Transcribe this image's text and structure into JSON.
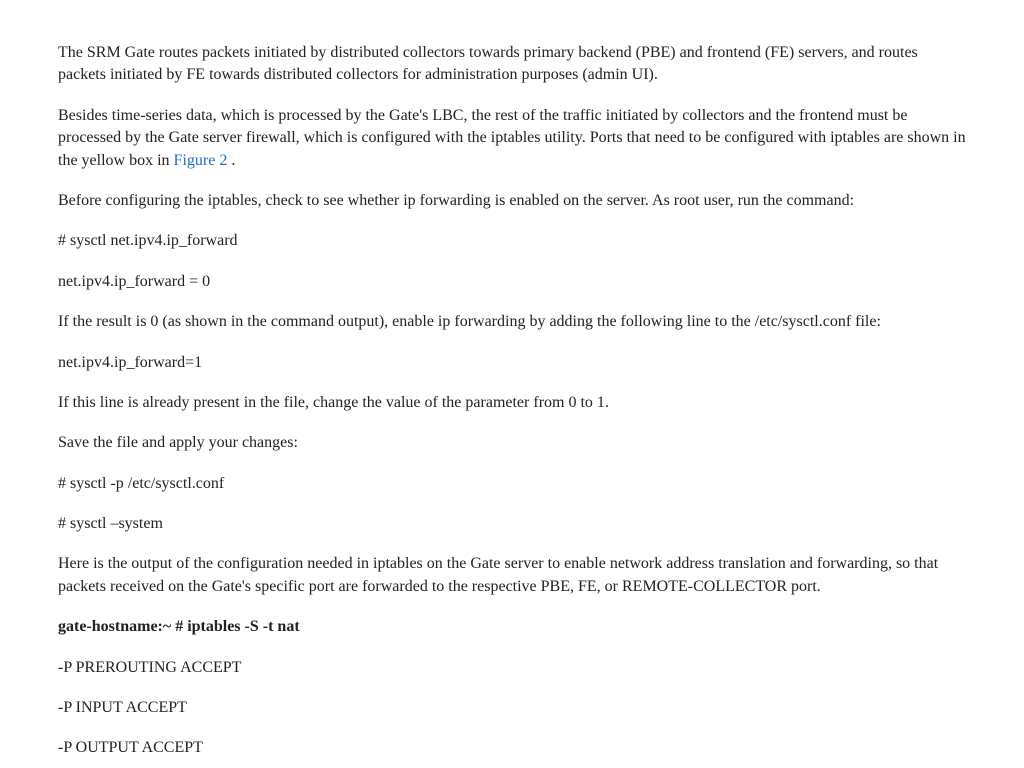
{
  "paragraphs": {
    "p1": "The SRM Gate routes packets initiated by distributed collectors towards primary backend (PBE) and frontend (FE) servers, and routes packets initiated by FE towards distributed collectors for administration purposes (admin UI).",
    "p2a": "Besides time-series data, which is processed by the Gate's LBC, the rest of the traffic initiated by collectors and the frontend must be processed by the Gate server firewall, which is configured with the iptables utility. Ports that need to be configured with iptables are shown in the yellow box in ",
    "p2link": "Figure 2",
    "p2b": " .",
    "p3": "Before configuring the iptables, check to see whether ip forwarding is enabled on the server. As root user, run the command:",
    "p4": "# sysctl net.ipv4.ip_forward",
    "p5": "net.ipv4.ip_forward = 0",
    "p6": "If the result is 0 (as shown in the command output), enable ip forwarding by adding the following line to the /etc/sysctl.conf file:",
    "p7": "net.ipv4.ip_forward=1",
    "p8": "If this line is already present in the file, change the value of the parameter from 0 to 1.",
    "p9": "Save the file and apply your changes:",
    "p10": "# sysctl -p /etc/sysctl.conf",
    "p11": "# sysctl –system",
    "p12": "Here is the output of the configuration needed in iptables on the Gate server to enable network address translation and forwarding, so that packets received on the Gate's specific port are forwarded to the respective PBE, FE, or REMOTE-COLLECTOR port.",
    "p13": "gate-hostname:~ # iptables -S -t nat",
    "p14": "-P PREROUTING ACCEPT",
    "p15": "-P INPUT ACCEPT",
    "p16": "-P OUTPUT ACCEPT"
  }
}
